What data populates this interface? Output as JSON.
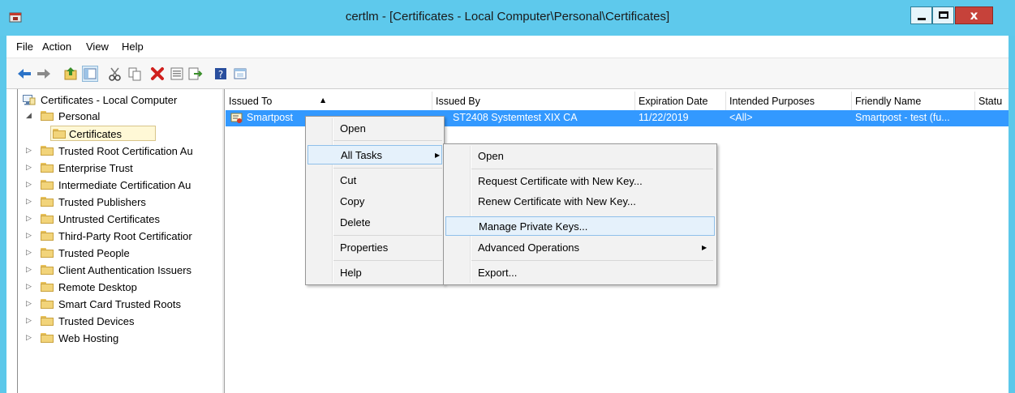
{
  "window": {
    "title": "certlm - [Certificates - Local Computer\\Personal\\Certificates]",
    "close_glyph": "x"
  },
  "menubar": {
    "items": [
      "File",
      "Action",
      "View",
      "Help"
    ]
  },
  "toolbar": {
    "icons": [
      "back-arrow-icon",
      "forward-arrow-icon",
      "up-folder-icon",
      "show-hide-tree-icon",
      "cut-icon",
      "copy-icon",
      "delete-icon",
      "properties-icon",
      "export-list-icon",
      "help-icon",
      "console-view-icon"
    ]
  },
  "tree": {
    "root": "Certificates - Local Computer",
    "personal": "Personal",
    "certificates": "Certificates",
    "items": [
      "Trusted Root Certification Au",
      "Enterprise Trust",
      "Intermediate Certification Au",
      "Trusted Publishers",
      "Untrusted Certificates",
      "Third-Party Root Certificatior",
      "Trusted People",
      "Client Authentication Issuers",
      "Remote Desktop",
      "Smart Card Trusted Roots",
      "Trusted Devices",
      "Web Hosting"
    ]
  },
  "list": {
    "columns": [
      "Issued To",
      "Issued By",
      "Expiration Date",
      "Intended Purposes",
      "Friendly Name",
      "Statu"
    ],
    "rows": [
      {
        "issued_to": "Smartpost",
        "issued_by": "ST2408 Systemtest XIX CA",
        "expiration": "11/22/2019",
        "purposes": "<All>",
        "friendly": "Smartpost - test (fu..."
      }
    ]
  },
  "context_menu": {
    "items": [
      "Open",
      "All Tasks",
      "Cut",
      "Copy",
      "Delete",
      "Properties",
      "Help"
    ]
  },
  "submenu": {
    "items": [
      "Open",
      "Request Certificate with New Key...",
      "Renew Certificate with New Key...",
      "Manage Private Keys...",
      "Advanced Operations",
      "Export..."
    ]
  },
  "colors": {
    "titlebar": "#5ec9ec",
    "selection": "#3399ff",
    "menu_highlight": "#e5f1fb"
  }
}
